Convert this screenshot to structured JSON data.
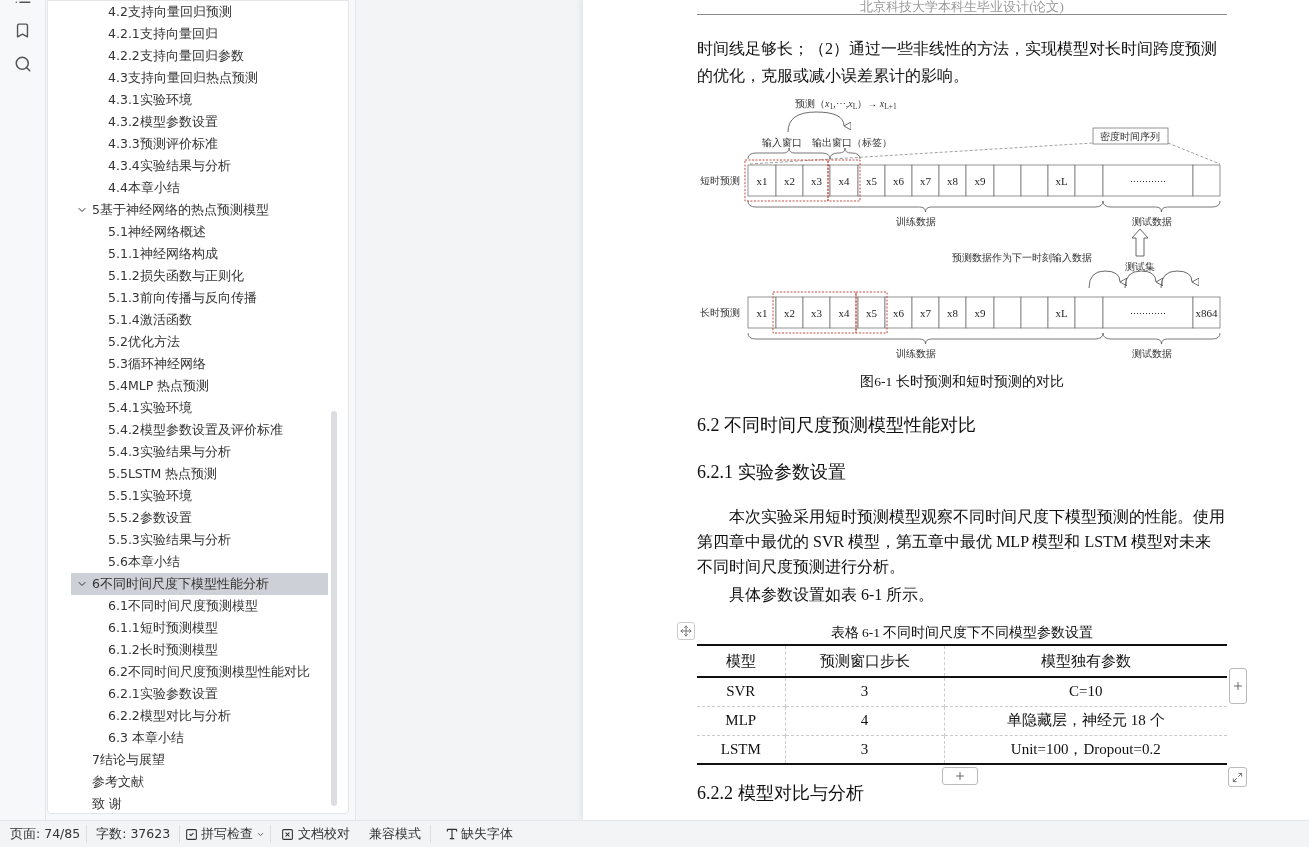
{
  "sidebar": {
    "outline": [
      {
        "children": [
          {
            "title": "4.2支持向量回归预测",
            "selected": false
          },
          {
            "title": "4.2.1支持向量回归",
            "selected": false
          },
          {
            "title": "4.2.2支持向量回归参数",
            "selected": false
          },
          {
            "title": "4.3支持向量回归热点预测",
            "selected": false
          },
          {
            "title": "4.3.1实验环境",
            "selected": false
          },
          {
            "title": "4.3.2模型参数设置",
            "selected": false
          },
          {
            "title": "4.3.3预测评价标准",
            "selected": false
          },
          {
            "title": "4.3.4实验结果与分析",
            "selected": false
          },
          {
            "title": "4.4本章小结",
            "selected": false
          }
        ]
      },
      {
        "title": "5基于神经网络的热点预测模型",
        "selected": false,
        "expanded": true,
        "children": [
          {
            "title": "5.1神经网络概述",
            "selected": false
          },
          {
            "title": "5.1.1神经网络构成",
            "selected": false
          },
          {
            "title": "5.1.2损失函数与正则化",
            "selected": false
          },
          {
            "title": "5.1.3前向传播与反向传播",
            "selected": false
          },
          {
            "title": "5.1.4激活函数",
            "selected": false
          },
          {
            "title": "5.2优化方法",
            "selected": false
          },
          {
            "title": "5.3循环神经网络",
            "selected": false
          },
          {
            "title": "5.4MLP 热点预测",
            "selected": false
          },
          {
            "title": "5.4.1实验环境",
            "selected": false
          },
          {
            "title": "5.4.2模型参数设置及评价标准",
            "selected": false
          },
          {
            "title": "5.4.3实验结果与分析",
            "selected": false
          },
          {
            "title": "5.5LSTM 热点预测",
            "selected": false
          },
          {
            "title": "5.5.1实验环境",
            "selected": false
          },
          {
            "title": "5.5.2参数设置",
            "selected": false
          },
          {
            "title": "5.5.3实验结果与分析",
            "selected": false
          },
          {
            "title": "5.6本章小结",
            "selected": false
          }
        ]
      },
      {
        "title": "6不同时间尺度下模型性能分析",
        "selected": true,
        "expanded": true,
        "children": [
          {
            "title": "6.1不同时间尺度预测模型",
            "selected": false
          },
          {
            "title": "6.1.1短时预测模型",
            "selected": false
          },
          {
            "title": "6.1.2长时预测模型",
            "selected": false
          },
          {
            "title": "6.2不同时间尺度预测模型性能对比",
            "selected": false
          },
          {
            "title": "6.2.1实验参数设置",
            "selected": false
          },
          {
            "title": "6.2.2模型对比与分析",
            "selected": false
          },
          {
            "title": "6.3 本章小结",
            "selected": false
          }
        ]
      },
      {
        "title": "7结论与展望",
        "selected": false
      },
      {
        "title": "参考文献",
        "selected": false
      },
      {
        "title": "致 谢",
        "selected": false
      }
    ]
  },
  "document": {
    "header": "北京科技大学本科生毕业设计(论文)",
    "intro_paragraph": "时间线足够长；（2）通过一些非线性的方法，实现模型对长时间跨度预测的优化，克服或减小误差累计的影响。",
    "figure": {
      "formula": "预测（*x*$_{1}$,⋯,*x*$_{L}$）→ *x*$_{L+1}$",
      "input_window_label": "输入窗口",
      "output_window_label": "输出窗口（标签）",
      "series_label": "密度时间序列",
      "test_set_label": "测试集",
      "feedback_label": "预测数据作为下一时刻输入数据",
      "rows": [
        {
          "label": "短时预测",
          "train_label": "训练数据",
          "test_label": "测试数据",
          "cells": [
            {
              "kind": "value",
              "text": "x1"
            },
            {
              "kind": "value",
              "text": "x2"
            },
            {
              "kind": "value",
              "text": "x3"
            },
            {
              "kind": "value",
              "text": "x4"
            },
            {
              "kind": "value",
              "text": "x5"
            },
            {
              "kind": "value",
              "text": "x6"
            },
            {
              "kind": "value",
              "text": "x7"
            },
            {
              "kind": "value",
              "text": "x8"
            },
            {
              "kind": "value",
              "text": "x9"
            },
            {
              "kind": "blank"
            },
            {
              "kind": "blank"
            },
            {
              "kind": "value",
              "text": "xL"
            },
            {
              "kind": "blank"
            },
            {
              "kind": "wide",
              "text": "…………"
            },
            {
              "kind": "blank"
            }
          ]
        },
        {
          "label": "长时预测",
          "train_label": "训练数据",
          "test_label": "测试数据",
          "cells": [
            {
              "kind": "value",
              "text": "x1"
            },
            {
              "kind": "value",
              "text": "x2"
            },
            {
              "kind": "value",
              "text": "x3"
            },
            {
              "kind": "value",
              "text": "x4"
            },
            {
              "kind": "value",
              "text": "x5"
            },
            {
              "kind": "value",
              "text": "x6"
            },
            {
              "kind": "value",
              "text": "x7"
            },
            {
              "kind": "value",
              "text": "x8"
            },
            {
              "kind": "value",
              "text": "x9"
            },
            {
              "kind": "blank"
            },
            {
              "kind": "blank"
            },
            {
              "kind": "value",
              "text": "xL"
            },
            {
              "kind": "blank"
            },
            {
              "kind": "wide",
              "text": "…………"
            },
            {
              "kind": "value",
              "text": "x864"
            }
          ]
        }
      ],
      "caption": "图6-1 长时预测和短时预测的对比"
    },
    "heading_2": "6.2 不同时间尺度预测模型性能对比",
    "heading_3": "6.2.1 实验参数设置",
    "paragraph_1": "本次实验采用短时预测模型观察不同时间尺度下模型预测的性能。使用第四章中最优的 SVR 模型，第五章中最优 MLP 模型和 LSTM 模型对未来不同时间尺度预测进行分析。",
    "paragraph_2": "具体参数设置如表 6-1 所示。",
    "table": {
      "caption": "表格 6-1 不同时间尺度下不同模型参数设置",
      "columns": [
        "模型",
        "预测窗口步长",
        "模型独有参数"
      ],
      "rows": [
        [
          "SVR",
          "3",
          "C=10"
        ],
        [
          "MLP",
          "4",
          "单隐藏层，神经元 18 个"
        ],
        [
          "LSTM",
          "3",
          "Unit=100，Dropout=0.2"
        ]
      ]
    },
    "heading_3b": "6.2.2 模型对比与分析"
  },
  "status_bar": {
    "page": "页面: 74/85",
    "word_count": "字数: 37623",
    "spell_check": "拼写检查",
    "proofread": "文档校对",
    "compat_mode": "兼容模式",
    "missing_fonts": "缺失字体"
  }
}
